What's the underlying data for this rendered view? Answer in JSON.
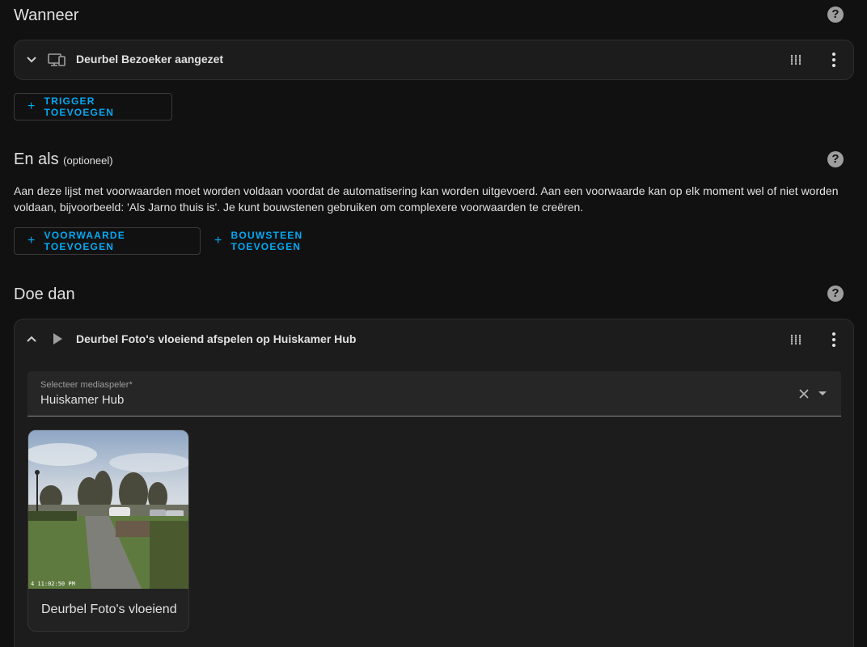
{
  "when": {
    "title": "Wanneer",
    "trigger_title": "Deurbel Bezoeker aangezet",
    "add_trigger_label": "TRIGGER TOEVOEGEN"
  },
  "and_if": {
    "title": "En als",
    "optional": "(optioneel)",
    "description": "Aan deze lijst met voorwaarden moet worden voldaan voordat de automatisering kan worden uitgevoerd. Aan een voorwaarde kan op elk moment wel of niet worden voldaan, bijvoorbeeld: 'Als Jarno thuis is'. Je kunt bouwstenen gebruiken om complexere voorwaarden te creëren.",
    "add_condition_label": "VOORWAARDE TOEVOEGEN",
    "add_building_block_label": "BOUWSTEEN TOEVOEGEN"
  },
  "then_do": {
    "title": "Doe dan",
    "action_title": "Deurbel Foto's vloeiend afspelen op Huiskamer Hub",
    "select_label": "Selecteer mediaspeler*",
    "select_value": "Huiskamer Hub",
    "media_title": "Deurbel Foto's vloeiend",
    "media_timestamp": "4 11:02:50 PM"
  },
  "colors": {
    "accent": "#03a9f4",
    "background": "#111111",
    "card": "#1c1c1c"
  },
  "icons": {
    "collapse": "chevron-down-icon",
    "expand": "chevron-up-icon",
    "device": "devices-icon",
    "play": "play-icon",
    "drag": "drag-handle-icon",
    "menu": "dots-vertical-icon",
    "help": "help-circle-icon",
    "add": "plus-icon",
    "clear": "close-icon",
    "dropdown": "menu-down-icon"
  }
}
